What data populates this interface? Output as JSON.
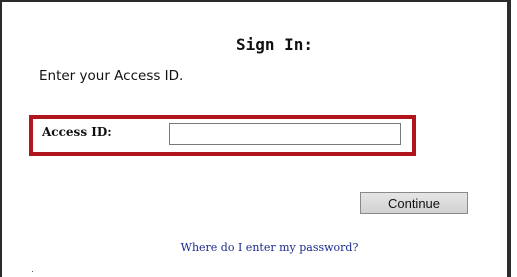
{
  "signin": {
    "title": "Sign In:",
    "instruction": "Enter your Access ID.",
    "access_id_label": "Access ID:",
    "access_id_value": "",
    "access_id_placeholder": "",
    "continue_label": "Continue",
    "help_link": "Where do I enter my password?"
  },
  "colors": {
    "highlight": "#b0151b",
    "link": "#1a2a8a",
    "border": "#2b2b2b"
  }
}
